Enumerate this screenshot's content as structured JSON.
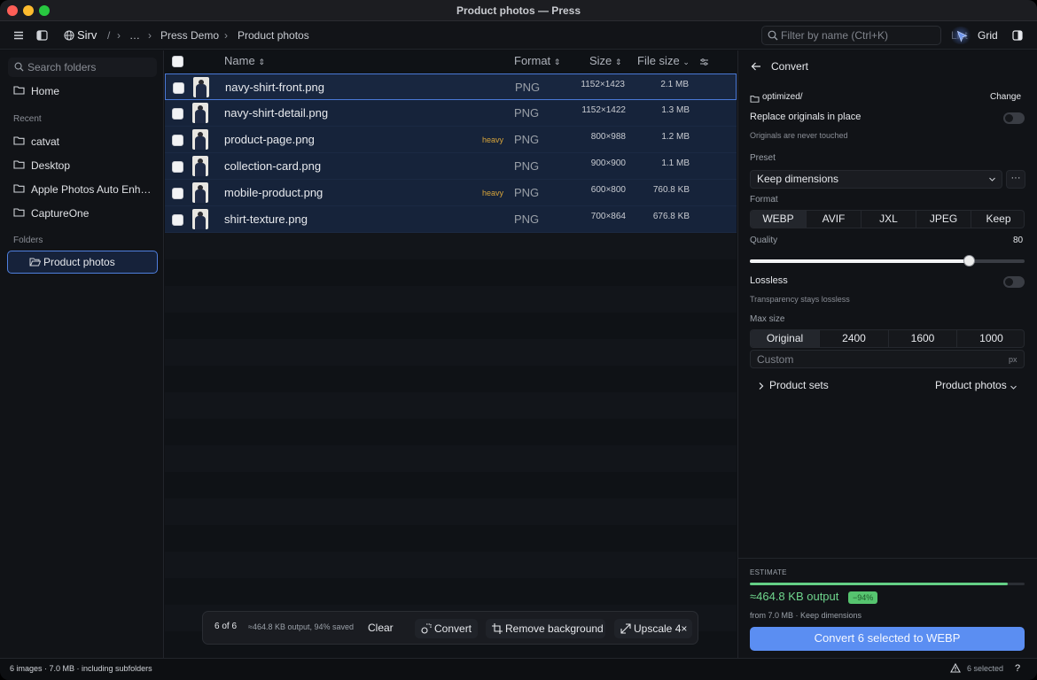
{
  "window": {
    "title": "Product photos — Press"
  },
  "toolbar": {
    "location": "Sirv",
    "path_sep": "/",
    "ellipsis": "…",
    "crumb1": "Press Demo",
    "crumb2": "Product photos",
    "filter_placeholder": "Filter by name (Ctrl+K)",
    "view_list": "List",
    "view_grid": "Grid"
  },
  "sidebar": {
    "search_placeholder": "Search folders",
    "home": "Home",
    "recent_header": "Recent",
    "recent": [
      "catvat",
      "Desktop",
      "Apple Photos Auto Enh…",
      "CaptureOne"
    ],
    "folders_header": "Folders",
    "active_folder": "Product photos"
  },
  "table": {
    "col_name": "Name",
    "col_format": "Format",
    "col_size": "Size",
    "col_filesize": "File size",
    "rows": [
      {
        "name": "navy-shirt-front.png",
        "badge": "",
        "format": "PNG",
        "dims": "1152×1423",
        "filesize": "2.1 MB"
      },
      {
        "name": "navy-shirt-detail.png",
        "badge": "",
        "format": "PNG",
        "dims": "1152×1422",
        "filesize": "1.3 MB"
      },
      {
        "name": "product-page.png",
        "badge": "heavy",
        "format": "PNG",
        "dims": "800×988",
        "filesize": "1.2 MB"
      },
      {
        "name": "collection-card.png",
        "badge": "",
        "format": "PNG",
        "dims": "900×900",
        "filesize": "1.1 MB"
      },
      {
        "name": "mobile-product.png",
        "badge": "heavy",
        "format": "PNG",
        "dims": "600×800",
        "filesize": "760.8 KB"
      },
      {
        "name": "shirt-texture.png",
        "badge": "",
        "format": "PNG",
        "dims": "700×864",
        "filesize": "676.8 KB"
      }
    ]
  },
  "actionbar": {
    "count": "6 of 6",
    "summary": "≈464.8 KB output, 94% saved",
    "clear": "Clear",
    "convert": "Convert",
    "remove_bg": "Remove background",
    "upscale": "Upscale 4×"
  },
  "panel": {
    "title": "Convert",
    "output_folder": "optimized/",
    "change": "Change",
    "replace_label": "Replace originals in place",
    "replace_on": false,
    "replace_note": "Originals are never touched",
    "preset_label": "Preset",
    "preset_value": "Keep dimensions",
    "more": "···",
    "format_label": "Format",
    "formats": [
      "WEBP",
      "AVIF",
      "JXL",
      "JPEG",
      "Keep"
    ],
    "selected_format": "WEBP",
    "quality_label": "Quality",
    "quality_value": "80",
    "quality": 80,
    "lossless_label": "Lossless",
    "lossless_on": false,
    "lossless_note": "Transparency stays lossless",
    "maxsize_label": "Max size",
    "maxsizes": [
      "Original",
      "2400",
      "1600",
      "1000"
    ],
    "selected_maxsize": "Original",
    "custom_placeholder": "Custom",
    "custom_unit": "px",
    "product_sets_label": "Product sets",
    "product_sets_value": "Product photos",
    "estimate_header": "ESTIMATE",
    "estimate_output": "≈464.8 KB output",
    "estimate_saved": "−94%",
    "estimate_saved_fraction": 0.94,
    "estimate_from": "from 7.0 MB · Keep dimensions",
    "convert_button": "Convert 6 selected to WEBP"
  },
  "statusbar": {
    "info": "6 images · 7.0 MB · including subfolders",
    "selected": "6 selected",
    "help": "?"
  },
  "colors": {
    "accent": "#5b8ef2",
    "selection_row": "#16233a",
    "heavy_badge": "#d7a43a",
    "saved_badge": "#56c46f"
  }
}
